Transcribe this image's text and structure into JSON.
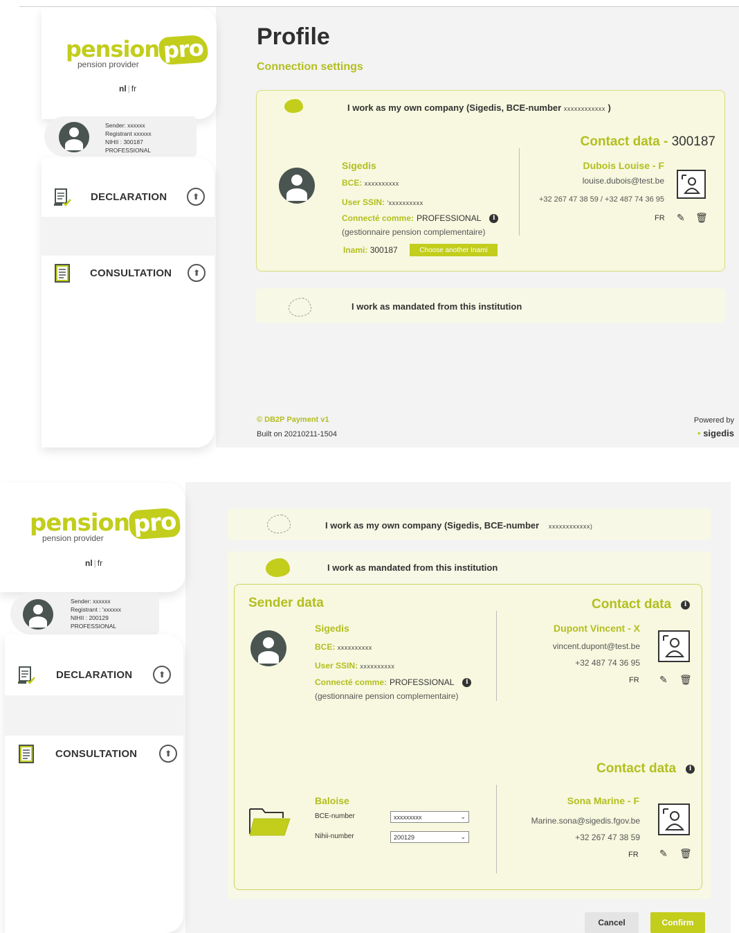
{
  "colors": {
    "accent": "#c2cd1c",
    "accent_text": "#b3be1f",
    "dark": "#333333",
    "panel": "#f3f3f3",
    "card_bg": "#f7f8df"
  },
  "logo": {
    "word1": "pension",
    "word2": "pro",
    "subtitle": "pension provider"
  },
  "lang": {
    "nl": "nl",
    "fr": "fr"
  },
  "nav": {
    "declaration": "DECLARATION",
    "consultation": "CONSULTATION"
  },
  "screen1": {
    "user": {
      "sender": "Sender:  xxxxxx",
      "registrant": "Registrant  xxxxxx",
      "nihii": "NIHII : 300187",
      "role": "PROFESSIONAL"
    },
    "title": "Profile",
    "subtitle": "Connection settings",
    "option1": {
      "label": "I work as my own company (Sigedis, BCE-number",
      "mask": "xxxxxxxxxxxx",
      "close": ")"
    },
    "sender": {
      "company": "Sigedis",
      "bce_label": "BCE:",
      "bce_value": "xxxxxxxxxx",
      "ssin_label": "User SSIN:",
      "ssin_value": "'xxxxxxxxxx",
      "connecte_label": "Connecté comme:",
      "connecte_value": "PROFESSIONAL",
      "role_desc": "(gestionnaire pension complementaire)",
      "inami_label": "Inami:",
      "inami_value": "300187",
      "choose_button": "Choose another Inami"
    },
    "contact": {
      "heading": "Contact data -",
      "heading_num": "300187",
      "name": "Dubois Louise - F",
      "email": "louise.dubois@test.be",
      "phones": "+32 267 47 38 59 / +32 487 74 36 95",
      "lang": "FR"
    },
    "option2": {
      "label": "I work as mandated from this institution"
    },
    "footer": {
      "copyright": "© DB2P Payment   v1",
      "build": "Built on 20210211-1504",
      "powered": "Powered by",
      "brand": "sigedis"
    }
  },
  "screen2": {
    "user": {
      "sender": "Sender:  xxxxxx",
      "registrant": "Registrant : 'xxxxxx",
      "nihii": "NIHII : 200129",
      "role": "PROFESSIONAL"
    },
    "option1": {
      "label": "I work as my own company (Sigedis, BCE-number",
      "mask": "xxxxxxxxxxxx)"
    },
    "option2": {
      "label": "I work as mandated from this institution"
    },
    "sender_heading": "Sender data",
    "sender": {
      "company": "Sigedis",
      "bce_label": "BCE:",
      "bce_value": "xxxxxxxxxx",
      "ssin_label": "User SSIN:",
      "ssin_value": "xxxxxxxxxx",
      "connecte_label": "Connecté comme:",
      "connecte_value": "PROFESSIONAL",
      "role_desc": "(gestionnaire pension complementaire)"
    },
    "contact1": {
      "heading": "Contact data",
      "name": "Dupont Vincent - X",
      "email": "vincent.dupont@test.be",
      "phone": "+32 487 74 36 95",
      "lang": "FR"
    },
    "institution": {
      "name": "Baloise",
      "bce_label": "BCE-number",
      "bce_value": "xxxxxxxxx",
      "nihii_label": "Nihii-number",
      "nihii_value": "200129"
    },
    "contact2": {
      "heading": "Contact data",
      "name": "Sona Marine - F",
      "email": "Marine.sona@sigedis.fgov.be",
      "phone": "+32 267 47 38 59",
      "lang": "FR"
    },
    "buttons": {
      "cancel": "Cancel",
      "confirm": "Confirm"
    }
  }
}
